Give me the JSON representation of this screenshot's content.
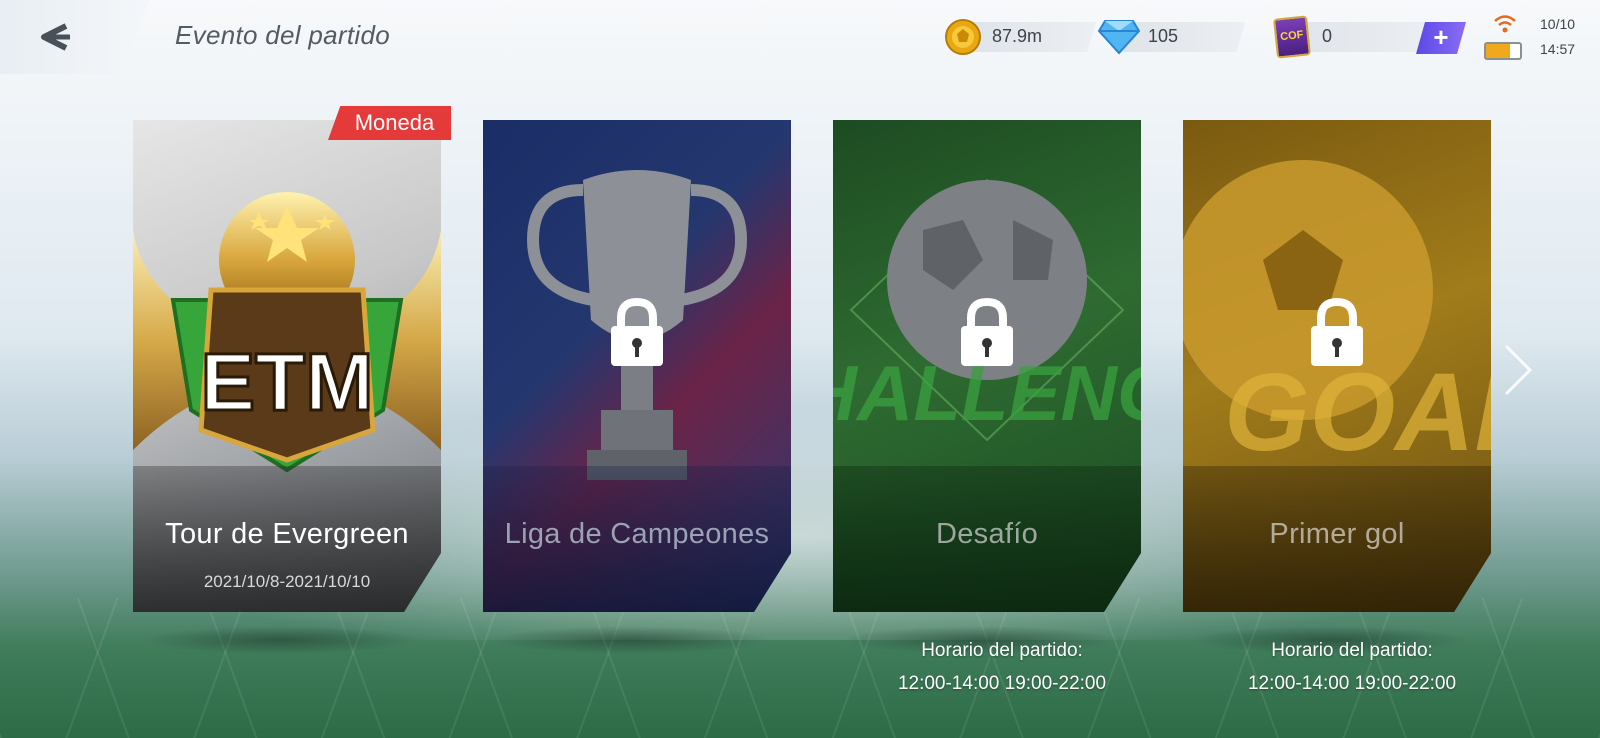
{
  "header": {
    "title": "Evento del partido",
    "back_icon": "back-arrow-icon"
  },
  "resources": {
    "coins": "87.9m",
    "gems": "105",
    "tickets": "0",
    "ticket_icon_text": "COF",
    "plus_label": "+"
  },
  "status": {
    "date": "10/10",
    "time": "14:57",
    "battery_color": "#f0a81c"
  },
  "cards": [
    {
      "title": "Tour de Evergreen",
      "subtitle": "2021/10/8-2021/10/10",
      "badge": "Moneda",
      "emblem_text": "ETM",
      "locked": false
    },
    {
      "title": "Liga de Campeones",
      "locked": true
    },
    {
      "title": "Desafío",
      "art_text": "CHALLENGE",
      "locked": true,
      "schedule_label": "Horario del partido:",
      "schedule_times": "12:00-14:00 19:00-22:00"
    },
    {
      "title": "Primer gol",
      "art_text": "GOAL",
      "locked": true,
      "schedule_label": "Horario del partido:",
      "schedule_times": "12:00-14:00 19:00-22:00"
    }
  ],
  "colors": {
    "badge_red": "#e43a3a",
    "plus_purple": "#6a55ec",
    "card_blue": "#1f2f63",
    "card_green": "#1f5a2b",
    "card_gold": "#8c6a12"
  }
}
